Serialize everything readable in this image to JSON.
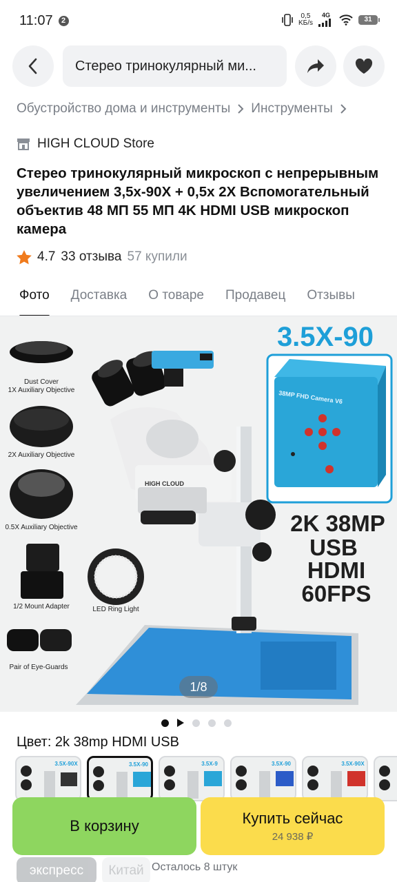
{
  "status": {
    "time": "11:07",
    "notif_count": "2",
    "net_speed_top": "0,5",
    "net_speed_bottom": "KБ/s",
    "net_type": "4G",
    "battery": "31"
  },
  "topbar": {
    "search_text": "Стерео тринокулярный ми...",
    "icons": [
      "chevron-left-icon",
      "share-icon",
      "heart-icon"
    ]
  },
  "breadcrumb": {
    "items": [
      "Обустройство дома и инструменты",
      "Инструменты"
    ]
  },
  "store": {
    "name": "HIGH CLOUD Store"
  },
  "product": {
    "title": "Стерео тринокулярный микроскоп с непрерывным увеличением 3,5x-90X + 0,5x 2X Вспомогательный объектив 48 МП 55 МП 4K HDMI USB микроскоп камера",
    "rating": "4.7",
    "reviews": "33 отзыва",
    "purchased": "57 купили"
  },
  "tabs": [
    "Фото",
    "Доставка",
    "О товаре",
    "Продавец",
    "Отзывы"
  ],
  "image": {
    "headline": "3.5X-90",
    "camera_label": "38MP FHD Camera V6",
    "specs": [
      "2K 38MP",
      "USB",
      "HDMI",
      "60FPS"
    ],
    "accessories": [
      "Dust Cover",
      "1X Auxiliary Objective",
      "2X Auxiliary Objective",
      "0.5X Auxiliary Objective",
      "1/2 Mount Adapter",
      "LED Ring Light",
      "Pair of Eye-Guards"
    ],
    "brand": "HIGH CLOUD",
    "counter": "1/8"
  },
  "gallery": {
    "dots": 5,
    "active_index": 0
  },
  "color": {
    "label": "Цвет: 2k 38mp HDMI USB",
    "thumbs": [
      "3.5X-90X",
      "3.5X-90",
      "3.5X-9",
      "3.5X-90",
      "3.5X-90X",
      ""
    ],
    "selected_index": 1
  },
  "actions": {
    "cart_label": "В корзину",
    "buy_label": "Купить сейчас",
    "buy_price": "24 938 ₽"
  },
  "footer": {
    "express": "экспресс",
    "china": "Китай",
    "stock": "Осталось 8 штук"
  },
  "colors": {
    "cart_green": "#8ed65f",
    "buy_yellow": "#fbdc4c",
    "accent_blue": "#1e9fd8",
    "star_orange": "#f07b1d"
  }
}
